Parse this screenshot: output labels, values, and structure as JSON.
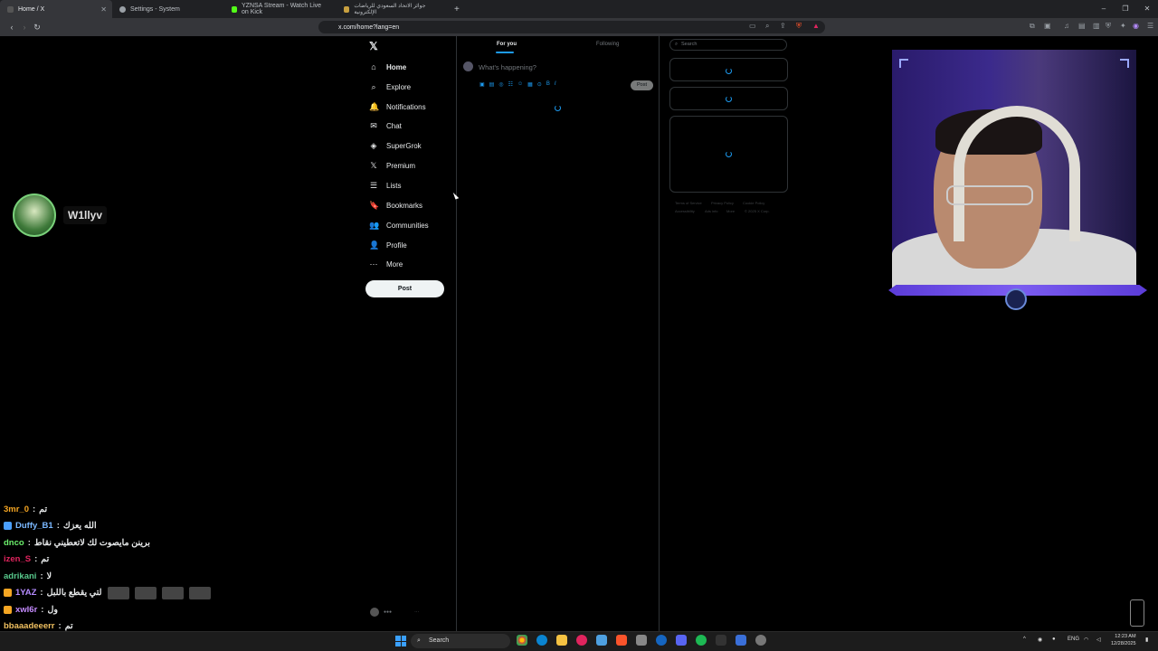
{
  "browser": {
    "tabs": [
      {
        "label": "Home / X",
        "active": true
      },
      {
        "label": "Settings - System"
      },
      {
        "label": "YZNSA Stream - Watch Live on Kick"
      },
      {
        "label": "جوائز الاتحاد السعودي للرياضات الإلكترونية"
      }
    ],
    "new_tab": "+",
    "url": "x.com/home?lang=en",
    "window_controls": [
      "–",
      "❐",
      "✕"
    ]
  },
  "x": {
    "logo": "𝕏",
    "nav": [
      {
        "label": "Home",
        "icon": "home-icon",
        "glyph": "⌂"
      },
      {
        "label": "Explore",
        "icon": "search-icon",
        "glyph": "⌕"
      },
      {
        "label": "Notifications",
        "icon": "bell-icon",
        "glyph": "🔔"
      },
      {
        "label": "Chat",
        "icon": "mail-icon",
        "glyph": "✉"
      },
      {
        "label": "SuperGrok",
        "icon": "grok-icon",
        "glyph": "◈"
      },
      {
        "label": "Premium",
        "icon": "x-premium-icon",
        "glyph": "𝕏"
      },
      {
        "label": "Lists",
        "icon": "list-icon",
        "glyph": "☰"
      },
      {
        "label": "Bookmarks",
        "icon": "bookmark-icon",
        "glyph": "🔖"
      },
      {
        "label": "Communities",
        "icon": "people-icon",
        "glyph": "👥"
      },
      {
        "label": "Profile",
        "icon": "person-icon",
        "glyph": "👤"
      },
      {
        "label": "More",
        "icon": "more-icon",
        "glyph": "⋯"
      }
    ],
    "post_button": "Post",
    "feed_tabs": [
      "For you",
      "Following"
    ],
    "composer_placeholder": "What's happening?",
    "composer_post": "Post",
    "search_placeholder": "Search",
    "footer_links": [
      "Terms of Service",
      "Privacy Policy",
      "Cookie Policy",
      "Accessibility",
      "Ads info",
      "More",
      "© 2025 X Corp."
    ],
    "accent": "#1d9bf0"
  },
  "stream": {
    "streamer_name": "W1llyv"
  },
  "chat": [
    {
      "user": "3mr_0",
      "msg": "تم",
      "color": "#f5a623"
    },
    {
      "user": "Duffy_B1",
      "msg": "الله يعزك",
      "color": "#7ab8ff"
    },
    {
      "user": "dnco",
      "msg": "برينن مايصوت لك لاتعطيني نقاط",
      "color": "#6cf06c"
    },
    {
      "user": "izen_S",
      "msg": "تم",
      "color": "#e0245e"
    },
    {
      "user": "adrikani",
      "msg": "لا",
      "color": "#58c98c"
    },
    {
      "user": "1YAZ",
      "msg": "لتي يقطع باللبل",
      "color": "#b58bff"
    },
    {
      "user": "xwl6r",
      "msg": "ول",
      "color": "#c58bff"
    },
    {
      "user": "bbaaadeeerr",
      "msg": "تم",
      "color": "#f0c060"
    }
  ],
  "taskbar": {
    "search": "Search",
    "lang": "ENG",
    "time": "12:23 AM",
    "date": "12/28/2025"
  }
}
